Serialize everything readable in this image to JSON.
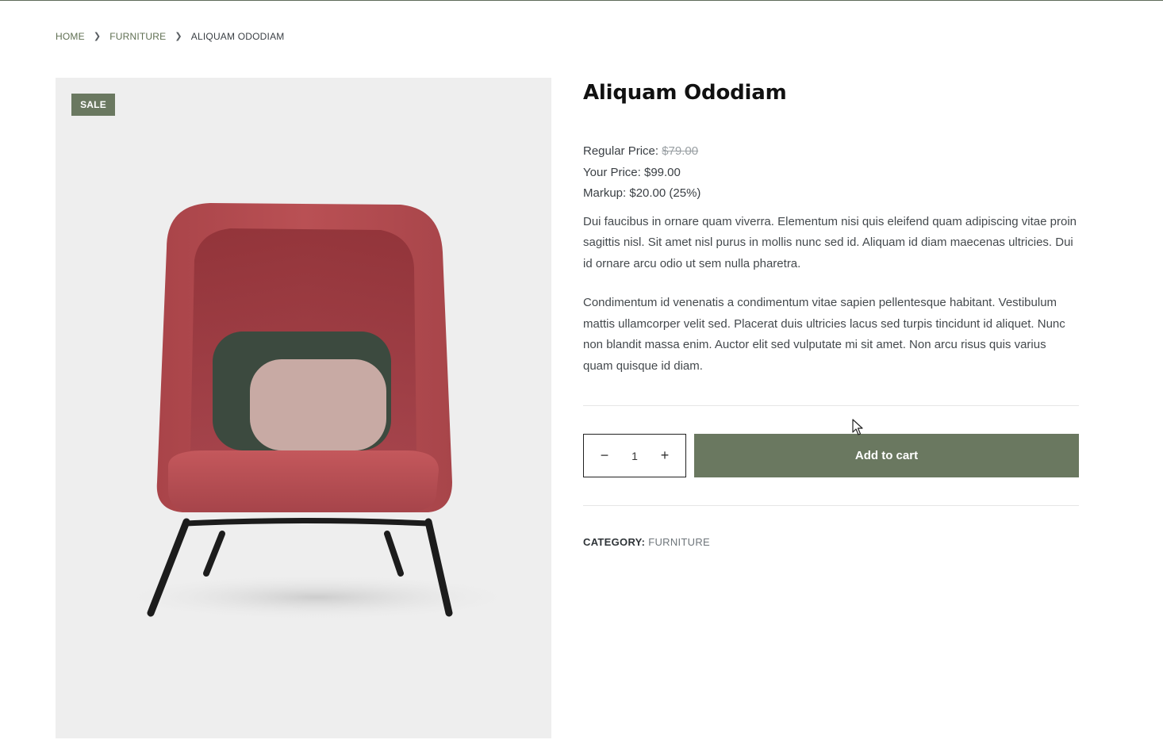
{
  "breadcrumb": {
    "home": "HOME",
    "category": "FURNITURE",
    "current": "ALIQUAM ODODIAM"
  },
  "product": {
    "badge": "SALE",
    "title": "Aliquam Ododiam",
    "regular_price_label": "Regular Price:",
    "regular_price": "$79.00",
    "your_price": "Your Price: $99.00",
    "markup": "Markup: $20.00 (25%)",
    "description_1": "Dui faucibus in ornare quam viverra. Elementum nisi quis eleifend quam adipiscing vitae proin sagittis nisl. Sit amet nisl purus in mollis nunc sed id. Aliquam id diam maecenas ultricies. Dui id ornare arcu odio ut sem nulla pharetra.",
    "description_2": "Condimentum id venenatis a condimentum vitae sapien pellentesque habitant. Vestibulum mattis ullamcorper velit sed. Placerat duis ultricies lacus sed turpis tincidunt id aliquet. Nunc non blandit massa enim. Auctor elit sed vulputate mi sit amet. Non arcu risus quis varius quam quisque id diam.",
    "quantity": "1",
    "minus_symbol": "−",
    "plus_symbol": "+",
    "add_to_cart": "Add to cart",
    "category_label": "CATEGORY:",
    "category_value": "FURNITURE"
  },
  "colors": {
    "accent": "#6a7860",
    "chair": "#b54a4e",
    "cushion_back": "#3c4a3f",
    "cushion_front": "#c8aaa4",
    "image_bg": "#eeeeee"
  },
  "icons": {
    "breadcrumb_separator": "chevron-right-icon",
    "cursor": "mouse-pointer-icon"
  }
}
